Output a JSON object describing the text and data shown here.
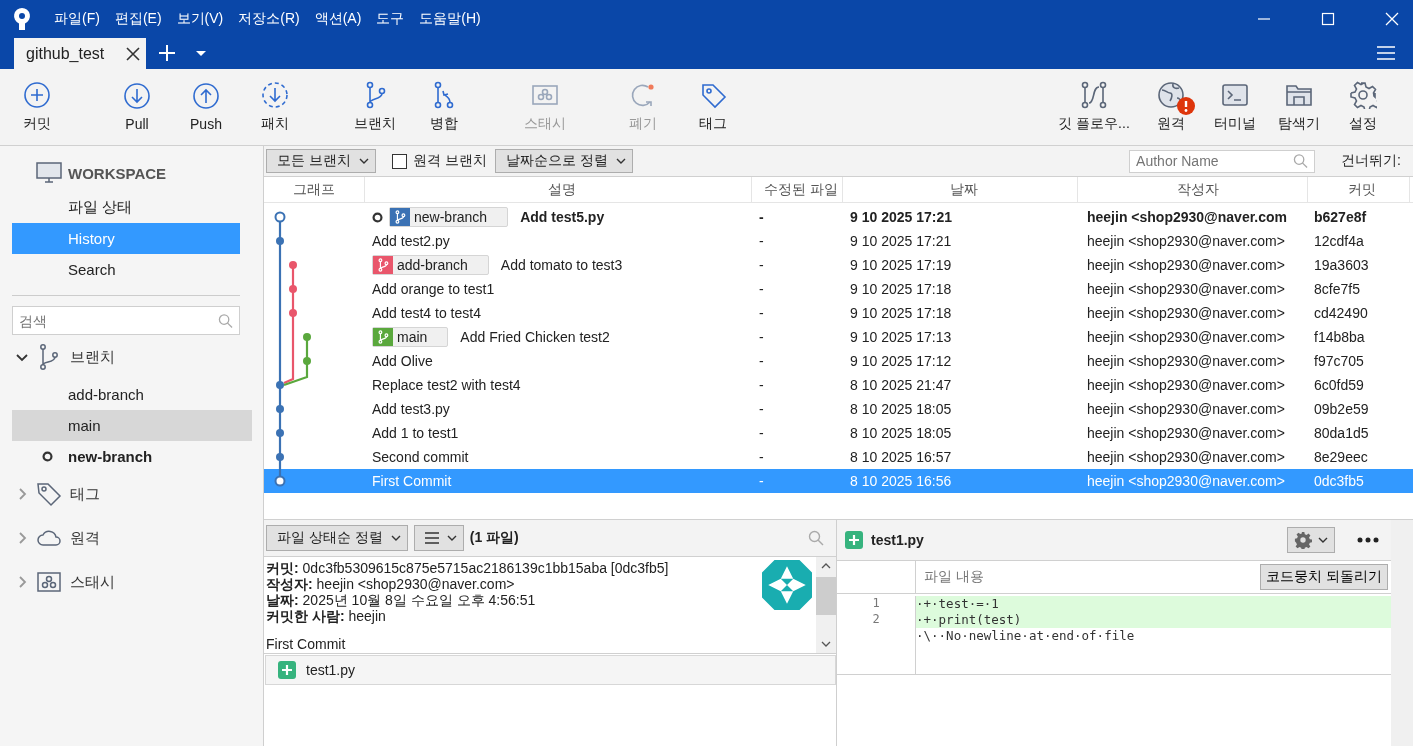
{
  "window": {
    "menu": [
      "파일(F)",
      "편집(E)",
      "보기(V)",
      "저장소(R)",
      "액션(A)",
      "도구",
      "도움말(H)"
    ],
    "tabs": [
      {
        "label": "github_test",
        "selected": true
      }
    ]
  },
  "toolbar": {
    "left": [
      {
        "label": "커밋",
        "disabled": false
      },
      {
        "label": "Pull",
        "disabled": false
      },
      {
        "label": "Push",
        "disabled": false
      },
      {
        "label": "패치",
        "disabled": false
      },
      {
        "label": "브랜치",
        "disabled": false
      },
      {
        "label": "병합",
        "disabled": false
      },
      {
        "label": "스태시",
        "disabled": true
      },
      {
        "label": "폐기",
        "disabled": true
      },
      {
        "label": "태그",
        "disabled": false
      }
    ],
    "right": [
      {
        "label": "깃 플로우...",
        "alert": false
      },
      {
        "label": "원격",
        "alert": true
      },
      {
        "label": "터미널",
        "alert": false
      },
      {
        "label": "탐색기",
        "alert": false
      },
      {
        "label": "설정",
        "alert": false
      }
    ]
  },
  "sidebar": {
    "workspace": {
      "title": "WORKSPACE",
      "items": [
        {
          "label": "파일 상태",
          "selected": false
        },
        {
          "label": "History",
          "selected": true
        },
        {
          "label": "Search",
          "selected": false
        }
      ]
    },
    "search": {
      "placeholder": "검색"
    },
    "sections": [
      {
        "label": "브랜치",
        "expanded": true,
        "children": [
          {
            "label": "add-branch",
            "selected": false,
            "current": false
          },
          {
            "label": "main",
            "selected": true,
            "current": false
          },
          {
            "label": "new-branch",
            "selected": false,
            "current": true
          }
        ]
      },
      {
        "label": "태그",
        "expanded": false
      },
      {
        "label": "원격",
        "expanded": false
      },
      {
        "label": "스태시",
        "expanded": false
      }
    ]
  },
  "filter_bar": {
    "branch_filter": "모든 브랜치",
    "remote_branches": {
      "label": "원격 브랜치",
      "checked": false
    },
    "sort": "날짜순으로 정렬",
    "author_search": {
      "placeholder": "Author Name"
    },
    "jump_label": "건너뛰기:"
  },
  "table": {
    "columns": [
      "그래프",
      "설명",
      "수정된 파일",
      "날짜",
      "작성자",
      "커밋"
    ],
    "rows": [
      {
        "refs": [
          {
            "name": "new-branch",
            "color": "#3b72b4"
          }
        ],
        "description": "Add test5.py",
        "current": true,
        "selected": false,
        "files": "-",
        "date": "9 10 2025 17:21",
        "author": "heejin <shop2930@naver.com",
        "commit": "b627e8f"
      },
      {
        "description": "Add test2.py",
        "current": false,
        "selected": false,
        "files": "-",
        "date": "9 10 2025 17:21",
        "author": "heejin <shop2930@naver.com>",
        "commit": "12cdf4a"
      },
      {
        "refs": [
          {
            "name": "add-branch",
            "color": "#e9566b"
          }
        ],
        "description": "Add tomato to test3",
        "current": false,
        "selected": false,
        "files": "-",
        "date": "9 10 2025 17:19",
        "author": "heejin <shop2930@naver.com>",
        "commit": "19a3603"
      },
      {
        "description": "Add orange to test1",
        "current": false,
        "selected": false,
        "files": "-",
        "date": "9 10 2025 17:18",
        "author": "heejin <shop2930@naver.com>",
        "commit": "8cfe7f5"
      },
      {
        "description": "Add test4 to test4",
        "current": false,
        "selected": false,
        "files": "-",
        "date": "9 10 2025 17:18",
        "author": "heejin <shop2930@naver.com>",
        "commit": "cd42490"
      },
      {
        "refs": [
          {
            "name": "main",
            "color": "#5aa83d"
          }
        ],
        "description": "Add Fried Chicken test2",
        "current": false,
        "selected": false,
        "files": "-",
        "date": "9 10 2025 17:13",
        "author": "heejin <shop2930@naver.com>",
        "commit": "f14b8ba"
      },
      {
        "description": "Add Olive",
        "current": false,
        "selected": false,
        "files": "-",
        "date": "9 10 2025 17:12",
        "author": "heejin <shop2930@naver.com>",
        "commit": "f97c705"
      },
      {
        "description": "Replace test2 with test4",
        "current": false,
        "selected": false,
        "files": "-",
        "date": "8 10 2025 21:47",
        "author": "heejin <shop2930@naver.com>",
        "commit": "6c0fd59"
      },
      {
        "description": "Add test3.py",
        "current": false,
        "selected": false,
        "files": "-",
        "date": "8 10 2025 18:05",
        "author": "heejin <shop2930@naver.com>",
        "commit": "09b2e59"
      },
      {
        "description": "Add 1 to test1",
        "current": false,
        "selected": false,
        "files": "-",
        "date": "8 10 2025 18:05",
        "author": "heejin <shop2930@naver.com>",
        "commit": "80da1d5"
      },
      {
        "description": "Second commit",
        "current": false,
        "selected": false,
        "files": "-",
        "date": "8 10 2025 16:57",
        "author": "heejin <shop2930@naver.com>",
        "commit": "8e29eec"
      },
      {
        "description": "First Commit",
        "current": false,
        "selected": true,
        "files": "-",
        "date": "8 10 2025 16:56",
        "author": "heejin <shop2930@naver.com>",
        "commit": "0dc3fb5"
      }
    ]
  },
  "commit_panel": {
    "sort": "파일 상태순 정렬",
    "file_count": "(1 파일)",
    "details": [
      {
        "label": "커밋:",
        "value": "0dc3fb5309615c875e5715ac2186139c1bb15aba [0dc3fb5]"
      },
      {
        "label": "작성자:",
        "value": "heejin <shop2930@naver.com>"
      },
      {
        "label": "날짜:",
        "value": "2025년 10월 8일 수요일 오후 4:56:51"
      },
      {
        "label": "커밋한 사람:",
        "value": "heejin"
      }
    ],
    "message": "First Commit",
    "files": [
      {
        "name": "test1.py",
        "kind": "added"
      }
    ]
  },
  "diff_panel": {
    "file": {
      "name": "test1.py",
      "kind": "added"
    },
    "header": "파일 내용",
    "revert_button": "코드뭉치 되돌리기",
    "lines": [
      {
        "number": "1",
        "text": "·+·test·=·1",
        "kind": "added"
      },
      {
        "number": "2",
        "text": "·+·print(test)",
        "kind": "added"
      },
      {
        "text": "·\\··No·newline·at·end·of·file",
        "kind": "note"
      }
    ]
  }
}
